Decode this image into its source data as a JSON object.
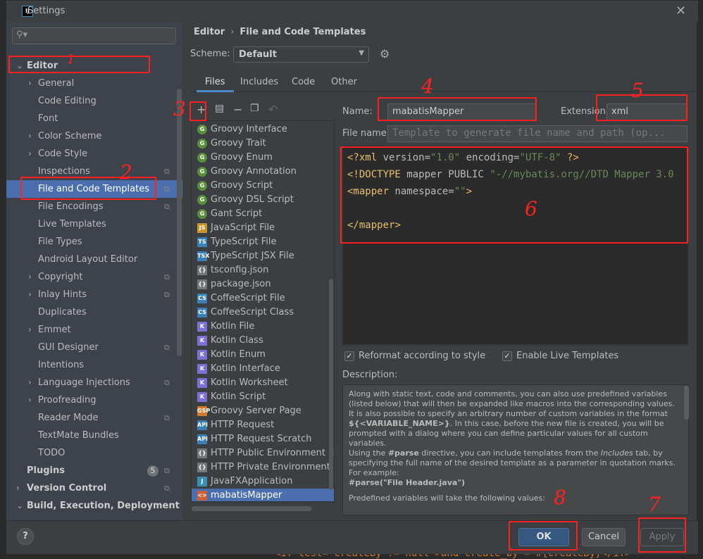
{
  "window": {
    "title": "Settings",
    "app_icon": "IJ"
  },
  "sidebar": {
    "search_placeholder": "",
    "items": [
      {
        "label": "Editor",
        "arrow": "v",
        "bold": true
      },
      {
        "label": "General",
        "arrow": ">"
      },
      {
        "label": "Code Editing"
      },
      {
        "label": "Font"
      },
      {
        "label": "Color Scheme",
        "arrow": ">"
      },
      {
        "label": "Code Style",
        "arrow": ">"
      },
      {
        "label": "Inspections",
        "copy": true
      },
      {
        "label": "File and Code Templates",
        "selected": true,
        "copy": true
      },
      {
        "label": "File Encodings",
        "copy": true
      },
      {
        "label": "Live Templates"
      },
      {
        "label": "File Types"
      },
      {
        "label": "Android Layout Editor"
      },
      {
        "label": "Copyright",
        "arrow": ">",
        "copy": true
      },
      {
        "label": "Inlay Hints",
        "arrow": ">",
        "copy": true
      },
      {
        "label": "Duplicates"
      },
      {
        "label": "Emmet",
        "arrow": ">"
      },
      {
        "label": "GUI Designer",
        "copy": true
      },
      {
        "label": "Intentions"
      },
      {
        "label": "Language Injections",
        "arrow": ">",
        "copy": true
      },
      {
        "label": "Proofreading",
        "arrow": ">"
      },
      {
        "label": "Reader Mode",
        "copy": true
      },
      {
        "label": "TextMate Bundles"
      },
      {
        "label": "TODO"
      },
      {
        "label": "Plugins",
        "bold": true,
        "badge": "5",
        "copy": true
      },
      {
        "label": "Version Control",
        "arrow": ">",
        "bold": true,
        "copy": true
      },
      {
        "label": "Build, Execution, Deployment",
        "arrow": "v",
        "bold": true
      }
    ]
  },
  "breadcrumb": {
    "parent": "Editor",
    "current": "File and Code Templates"
  },
  "scheme": {
    "label": "Scheme:",
    "value": "Default"
  },
  "tabs": [
    {
      "label": "Files",
      "active": true
    },
    {
      "label": "Includes"
    },
    {
      "label": "Code"
    },
    {
      "label": "Other"
    }
  ],
  "templates": [
    {
      "name": "Groovy Interface",
      "icon": "groovy"
    },
    {
      "name": "Groovy Trait",
      "icon": "groovy"
    },
    {
      "name": "Groovy Enum",
      "icon": "groovy"
    },
    {
      "name": "Groovy Annotation",
      "icon": "groovy"
    },
    {
      "name": "Groovy Script",
      "icon": "groovy"
    },
    {
      "name": "Groovy DSL Script",
      "icon": "groovy"
    },
    {
      "name": "Gant Script",
      "icon": "groovy"
    },
    {
      "name": "JavaScript File",
      "icon": "js"
    },
    {
      "name": "TypeScript File",
      "icon": "ts"
    },
    {
      "name": "TypeScript JSX File",
      "icon": "tsx"
    },
    {
      "name": "tsconfig.json",
      "icon": "json"
    },
    {
      "name": "package.json",
      "icon": "json"
    },
    {
      "name": "CoffeeScript File",
      "icon": "coffee"
    },
    {
      "name": "CoffeeScript Class",
      "icon": "coffee"
    },
    {
      "name": "Kotlin File",
      "icon": "kotlin"
    },
    {
      "name": "Kotlin Class",
      "icon": "kotlin"
    },
    {
      "name": "Kotlin Enum",
      "icon": "kotlin"
    },
    {
      "name": "Kotlin Interface",
      "icon": "kotlin"
    },
    {
      "name": "Kotlin Worksheet",
      "icon": "kotlin"
    },
    {
      "name": "Kotlin Script",
      "icon": "kotlin"
    },
    {
      "name": "Groovy Server Page",
      "icon": "gsp"
    },
    {
      "name": "HTTP Request",
      "icon": "api"
    },
    {
      "name": "HTTP Request Scratch",
      "icon": "api"
    },
    {
      "name": "HTTP Public Environment File",
      "icon": "http-env"
    },
    {
      "name": "HTTP Private Environment File",
      "icon": "http-env"
    },
    {
      "name": "JavaFXApplication",
      "icon": "java"
    },
    {
      "name": "mabatisMapper",
      "icon": "xml",
      "selected": true
    }
  ],
  "editor": {
    "name_label": "Name:",
    "name_value": "mabatisMapper",
    "extension_label": "Extension:",
    "extension_value": "xml",
    "filename_label": "File name:",
    "filename_placeholder": "Template to generate file name and path (op...",
    "code_lines": [
      "<?xml version=\"1.0\" encoding=\"UTF-8\" ?>",
      "<!DOCTYPE mapper PUBLIC \"-//mybatis.org//DTD Mapper 3.0",
      "<mapper namespace=\"\">",
      "",
      "</mapper>"
    ],
    "reformat_label": "Reformat according to style",
    "reformat_checked": true,
    "live_templates_label": "Enable Live Templates",
    "live_templates_checked": true,
    "description_label": "Description:",
    "description": {
      "p1": "Along with static text, code and comments, you can also use predefined variables (listed below) that will then be expanded like macros into the corresponding values.",
      "p2a": "It is also possible to specify an arbitrary number of custom variables in the format ",
      "p2b": "${<VARIABLE_NAME>}",
      "p2c": ". In this case, before the new file is created, you will be prompted with a dialog where you can define particular values for all custom variables.",
      "p3a": "Using the ",
      "p3b": "#parse",
      "p3c": " directive, you can include templates from the ",
      "p3d": "Includes",
      "p3e": " tab, by specifying the full name of the desired template as a parameter in quotation marks. For example:",
      "p4": "#parse(\"File Header.java\")",
      "p5": "Predefined variables will take the following values:"
    }
  },
  "footer": {
    "help": "?",
    "ok": "OK",
    "cancel": "Cancel",
    "apply": "Apply"
  },
  "annotations": {
    "color": "#ff2020",
    "labels": [
      "1",
      "2",
      "3",
      "4",
      "5",
      "6",
      "7",
      "8"
    ]
  },
  "colors": {
    "accent": "#4b6eaf",
    "ok_button": "#365880",
    "xml_tag": "#e8bf6a",
    "xml_value": "#6a8759"
  }
}
